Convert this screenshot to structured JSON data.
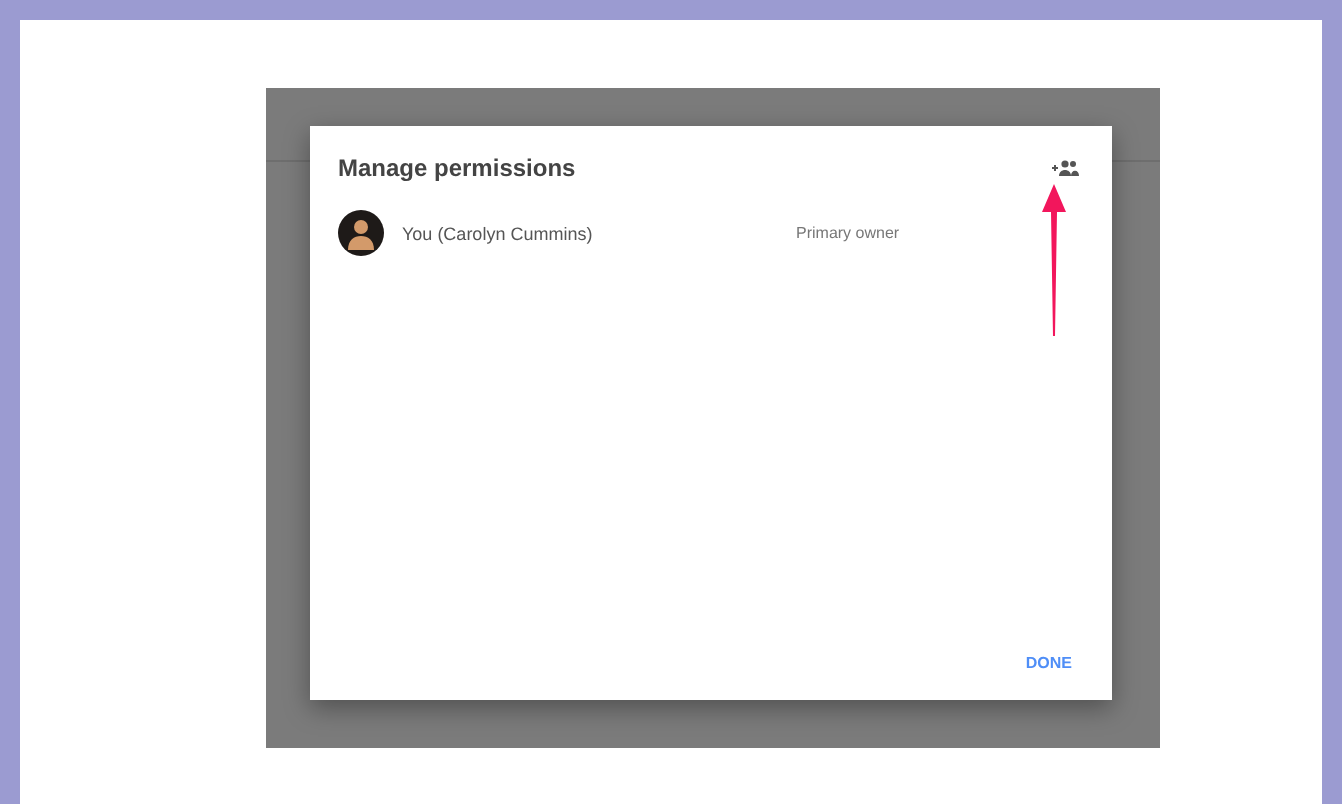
{
  "dialog": {
    "title": "Manage permissions",
    "members": [
      {
        "name": "You (Carolyn Cummins)",
        "role": "Primary owner"
      }
    ],
    "buttons": [
      "DONE"
    ]
  }
}
